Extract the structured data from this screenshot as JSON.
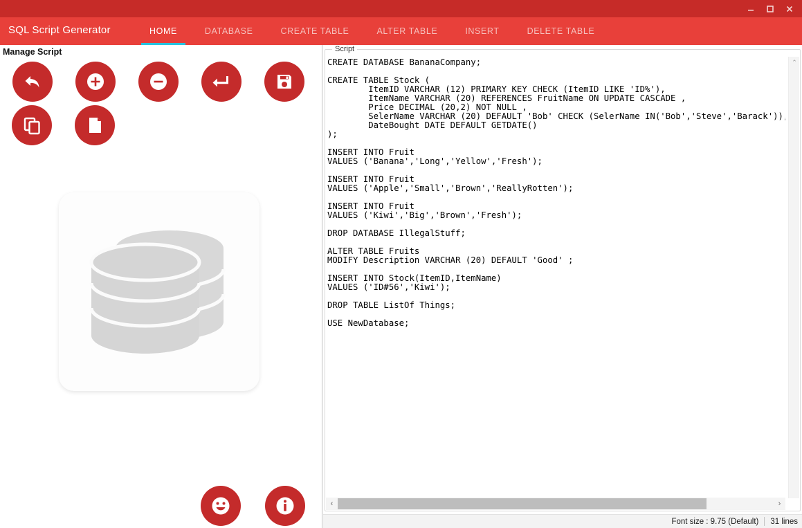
{
  "window": {
    "title_bar_color": "#c62b28",
    "nav_color": "#e8403a",
    "accent_underline": "#27c3e0",
    "icon_red": "#c42b2b",
    "controls": {
      "minimize": "minimize-icon",
      "maximize": "maximize-icon",
      "close": "close-icon"
    }
  },
  "header": {
    "brand": "SQL Script Generator",
    "tabs": [
      {
        "label": "HOME",
        "active": true
      },
      {
        "label": "DATABASE",
        "active": false
      },
      {
        "label": "CREATE TABLE",
        "active": false
      },
      {
        "label": "ALTER TABLE",
        "active": false
      },
      {
        "label": "INSERT",
        "active": false
      },
      {
        "label": "DELETE TABLE",
        "active": false
      }
    ]
  },
  "left_panel": {
    "section_title": "Manage Script",
    "buttons": [
      {
        "name": "undo-button",
        "icon": "undo-arrow-icon"
      },
      {
        "name": "add-button",
        "icon": "plus-circle-icon"
      },
      {
        "name": "remove-button",
        "icon": "minus-circle-icon"
      },
      {
        "name": "enter-button",
        "icon": "enter-arrow-icon"
      },
      {
        "name": "save-button",
        "icon": "floppy-disk-icon"
      },
      {
        "name": "copy-button",
        "icon": "copy-icon"
      },
      {
        "name": "new-file-button",
        "icon": "new-document-icon"
      }
    ],
    "illustration": "database-stack-icon",
    "bottom_buttons": [
      {
        "name": "smiley-button",
        "icon": "smiley-face-icon"
      },
      {
        "name": "info-button",
        "icon": "info-circle-icon"
      }
    ]
  },
  "script": {
    "groupbox_label": "Script",
    "content": "CREATE DATABASE BananaCompany;\n\nCREATE TABLE Stock (\n        ItemID VARCHAR (12) PRIMARY KEY CHECK (ItemID LIKE 'ID%'),\n        ItemName VARCHAR (20) REFERENCES FruitName ON UPDATE CASCADE ,\n        Price DECIMAL (20,2) NOT NULL ,\n        SelerName VARCHAR (20) DEFAULT 'Bob' CHECK (SelerName IN('Bob','Steve','Barack')),\n        DateBought DATE DEFAULT GETDATE()\n);\n\nINSERT INTO Fruit\nVALUES ('Banana','Long','Yellow','Fresh');\n\nINSERT INTO Fruit\nVALUES ('Apple','Small','Brown','ReallyRotten');\n\nINSERT INTO Fruit\nVALUES ('Kiwi','Big','Brown','Fresh');\n\nDROP DATABASE IllegalStuff;\n\nALTER TABLE Fruits\nMODIFY Description VARCHAR (20) DEFAULT 'Good' ;\n\nINSERT INTO Stock(ItemID,ItemName)\nVALUES ('ID#56','Kiwi');\n\nDROP TABLE ListOf Things;\n\nUSE NewDatabase;",
    "scroll": {
      "up_arrow": "⌃",
      "left_arrow": "‹",
      "right_arrow": "›"
    }
  },
  "statusbar": {
    "font_size": "Font size : 9.75 (Default)",
    "line_count": "31 lines"
  }
}
